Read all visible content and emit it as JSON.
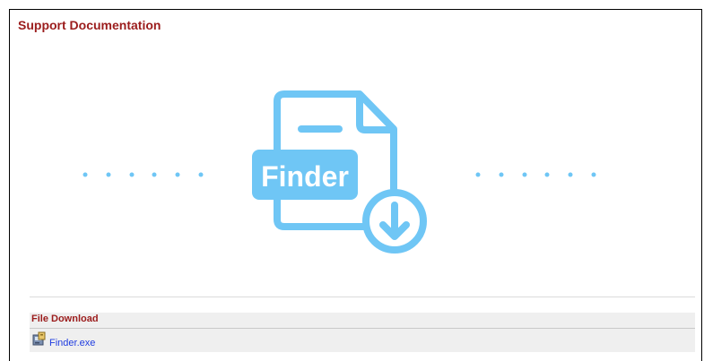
{
  "page": {
    "title": "Support Documentation"
  },
  "hero": {
    "icon_label": "Finder",
    "accent_color": "#6fc6f5"
  },
  "download": {
    "section_title": "File Download",
    "files": [
      {
        "name": "Finder.exe",
        "icon": "installer-icon"
      }
    ]
  }
}
